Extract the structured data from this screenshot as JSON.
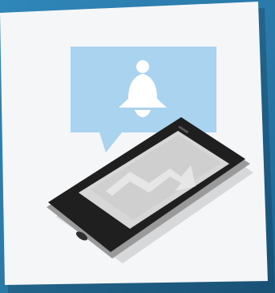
{
  "illustration": {
    "colors": {
      "background": "#2f7fae",
      "card": "#f5f6f7",
      "bubble": "#a9d3ee",
      "bell": "#ffffff",
      "phone_body": "#1f1f1f",
      "phone_edge": "#9a9a9a",
      "phone_screen": "#d7d7d7",
      "arrow": "#e6e6e6"
    },
    "icons": [
      "bell-icon",
      "smartphone-icon",
      "trend-arrow-icon"
    ]
  }
}
